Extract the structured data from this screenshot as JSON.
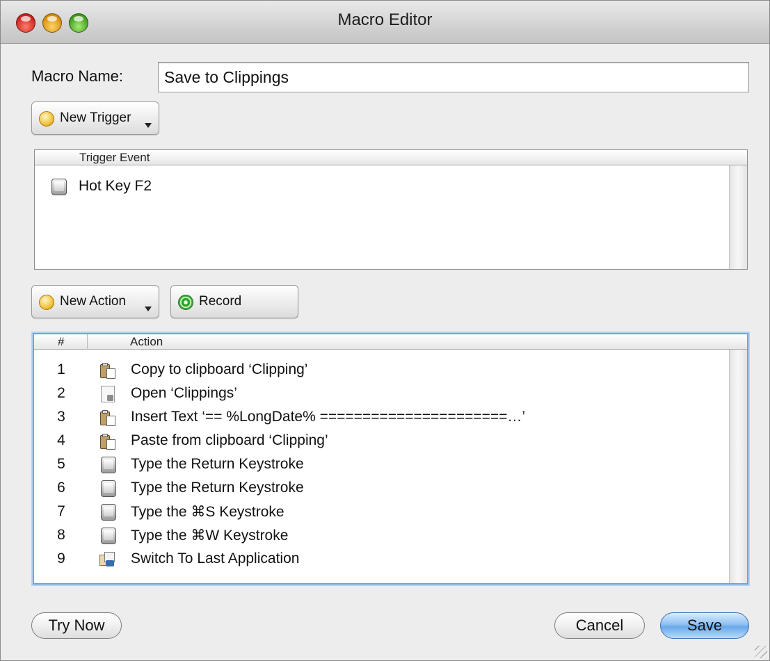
{
  "window": {
    "title": "Macro Editor"
  },
  "macro_name": {
    "label": "Macro Name:",
    "value": "Save to Clippings"
  },
  "trigger": {
    "new_trigger_label": "New Trigger",
    "column_header": "Trigger Event",
    "items": [
      {
        "icon": "keyboard-key-icon",
        "label": "Hot Key F2"
      }
    ]
  },
  "actions_toolbar": {
    "new_action_label": "New Action",
    "record_label": "Record"
  },
  "actions": {
    "columns": [
      "#",
      "Action"
    ],
    "rows": [
      {
        "num": "1",
        "icon": "clipboard-icon",
        "label": "Copy to clipboard ‘Clipping’"
      },
      {
        "num": "2",
        "icon": "document-icon",
        "label": "Open ‘Clippings’"
      },
      {
        "num": "3",
        "icon": "clipboard-icon",
        "label": "Insert Text ‘== %LongDate% ======================…’"
      },
      {
        "num": "4",
        "icon": "clipboard-icon",
        "label": "Paste from clipboard ‘Clipping’"
      },
      {
        "num": "5",
        "icon": "keyboard-key-icon",
        "label": "Type the Return Keystroke"
      },
      {
        "num": "6",
        "icon": "keyboard-key-icon",
        "label": "Type the Return Keystroke"
      },
      {
        "num": "7",
        "icon": "keyboard-key-icon",
        "label": "Type the ⌘S Keystroke"
      },
      {
        "num": "8",
        "icon": "keyboard-key-icon",
        "label": "Type the ⌘W Keystroke"
      },
      {
        "num": "9",
        "icon": "application-icon",
        "label": "Switch To Last Application"
      }
    ]
  },
  "footer": {
    "try_now_label": "Try Now",
    "cancel_label": "Cancel",
    "save_label": "Save"
  }
}
